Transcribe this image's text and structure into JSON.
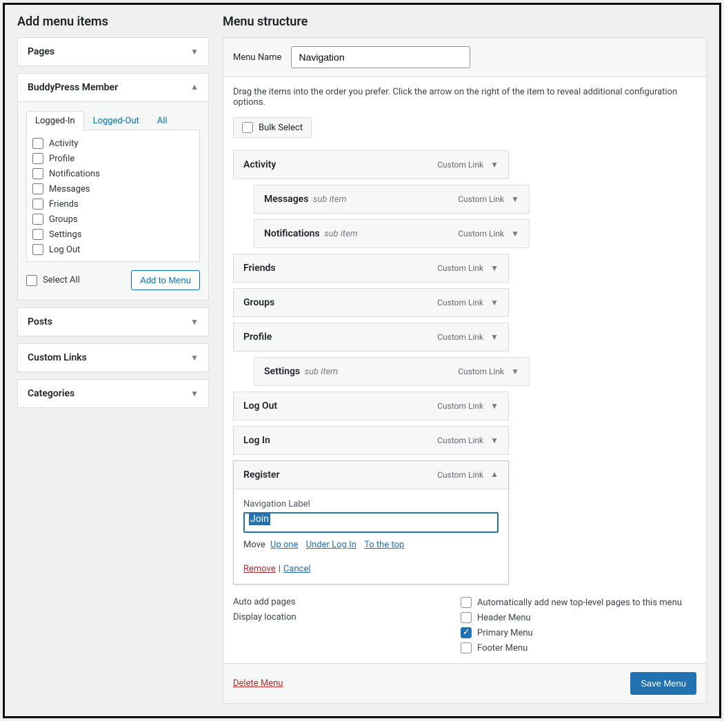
{
  "headings": {
    "add_menu_items": "Add menu items",
    "menu_structure": "Menu structure"
  },
  "left_panels": {
    "pages": "Pages",
    "buddypress": "BuddyPress Member",
    "posts": "Posts",
    "custom_links": "Custom Links",
    "categories": "Categories"
  },
  "bp_tabs": {
    "logged_in": "Logged-In",
    "logged_out": "Logged-Out",
    "all": "All"
  },
  "bp_items": [
    "Activity",
    "Profile",
    "Notifications",
    "Messages",
    "Friends",
    "Groups",
    "Settings",
    "Log Out"
  ],
  "select_all": "Select All",
  "add_to_menu": "Add to Menu",
  "menu_name_label": "Menu Name",
  "menu_name_value": "Navigation",
  "instructions": "Drag the items into the order you prefer. Click the arrow on the right of the item to reveal additional configuration options.",
  "bulk_select": "Bulk Select",
  "type_custom_link": "Custom Link",
  "sub_item_tag": "sub item",
  "menu_items": [
    {
      "title": "Activity",
      "sub": false
    },
    {
      "title": "Messages",
      "sub": true
    },
    {
      "title": "Notifications",
      "sub": true
    },
    {
      "title": "Friends",
      "sub": false
    },
    {
      "title": "Groups",
      "sub": false
    },
    {
      "title": "Profile",
      "sub": false
    },
    {
      "title": "Settings",
      "sub": true
    },
    {
      "title": "Log Out",
      "sub": false
    },
    {
      "title": "Log In",
      "sub": false
    }
  ],
  "expanded_item": {
    "title": "Register",
    "type": "Custom Link",
    "nav_label_label": "Navigation Label",
    "nav_label_value": "Join",
    "move_label": "Move",
    "move_up_one": "Up one",
    "move_under": "Under Log In",
    "move_top": "To the top",
    "remove": "Remove",
    "cancel": "Cancel"
  },
  "settings": {
    "auto_add_label": "Auto add pages",
    "auto_add_opt": "Automatically add new top-level pages to this menu",
    "display_label": "Display location",
    "loc_header": "Header Menu",
    "loc_primary": "Primary Menu",
    "loc_footer": "Footer Menu"
  },
  "footer": {
    "delete": "Delete Menu",
    "save": "Save Menu"
  }
}
